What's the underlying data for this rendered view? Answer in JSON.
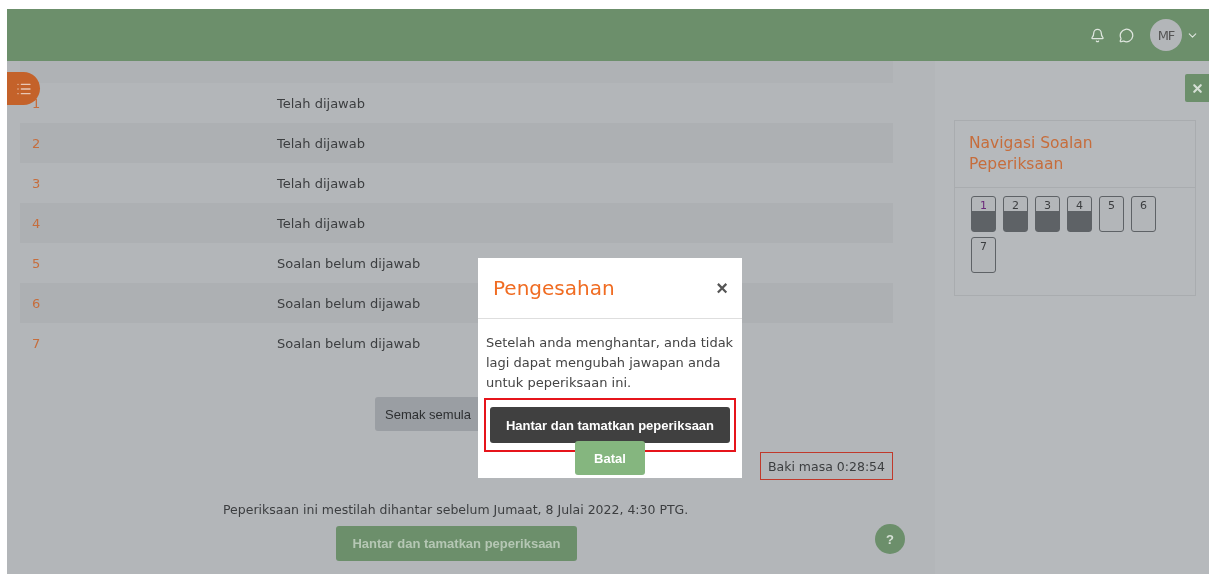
{
  "header": {
    "avatar": "MF"
  },
  "summary": {
    "rows": [
      {
        "number": "1",
        "status": "Telah dijawab"
      },
      {
        "number": "2",
        "status": "Telah dijawab"
      },
      {
        "number": "3",
        "status": "Telah dijawab"
      },
      {
        "number": "4",
        "status": "Telah dijawab"
      },
      {
        "number": "5",
        "status": "Soalan belum dijawab"
      },
      {
        "number": "6",
        "status": "Soalan belum dijawab"
      },
      {
        "number": "7",
        "status": "Soalan belum dijawab"
      }
    ]
  },
  "review_button": "Semak semula",
  "timer": "Baki masa 0:28:54",
  "deadline": "Peperiksaan ini mestilah dihantar sebelum Jumaat, 8 Julai 2022, 4:30 PTG.",
  "submit_button": "Hantar dan tamatkan peperiksaan",
  "help": "?",
  "navigation": {
    "title": "Navigasi Soalan Peperiksaan",
    "questions": [
      {
        "label": "1",
        "answered": true,
        "current": true
      },
      {
        "label": "2",
        "answered": true,
        "current": false
      },
      {
        "label": "3",
        "answered": true,
        "current": false
      },
      {
        "label": "4",
        "answered": true,
        "current": false
      },
      {
        "label": "5",
        "answered": false,
        "current": false
      },
      {
        "label": "6",
        "answered": false,
        "current": false
      },
      {
        "label": "7",
        "answered": false,
        "current": false
      }
    ]
  },
  "dialog": {
    "title": "Pengesahan",
    "close": "×",
    "message": "Setelah anda menghantar, anda tidak lagi dapat mengubah jawapan anda untuk peperiksaan ini.",
    "confirm": "Hantar dan tamatkan peperiksaan",
    "cancel": "Batal"
  }
}
